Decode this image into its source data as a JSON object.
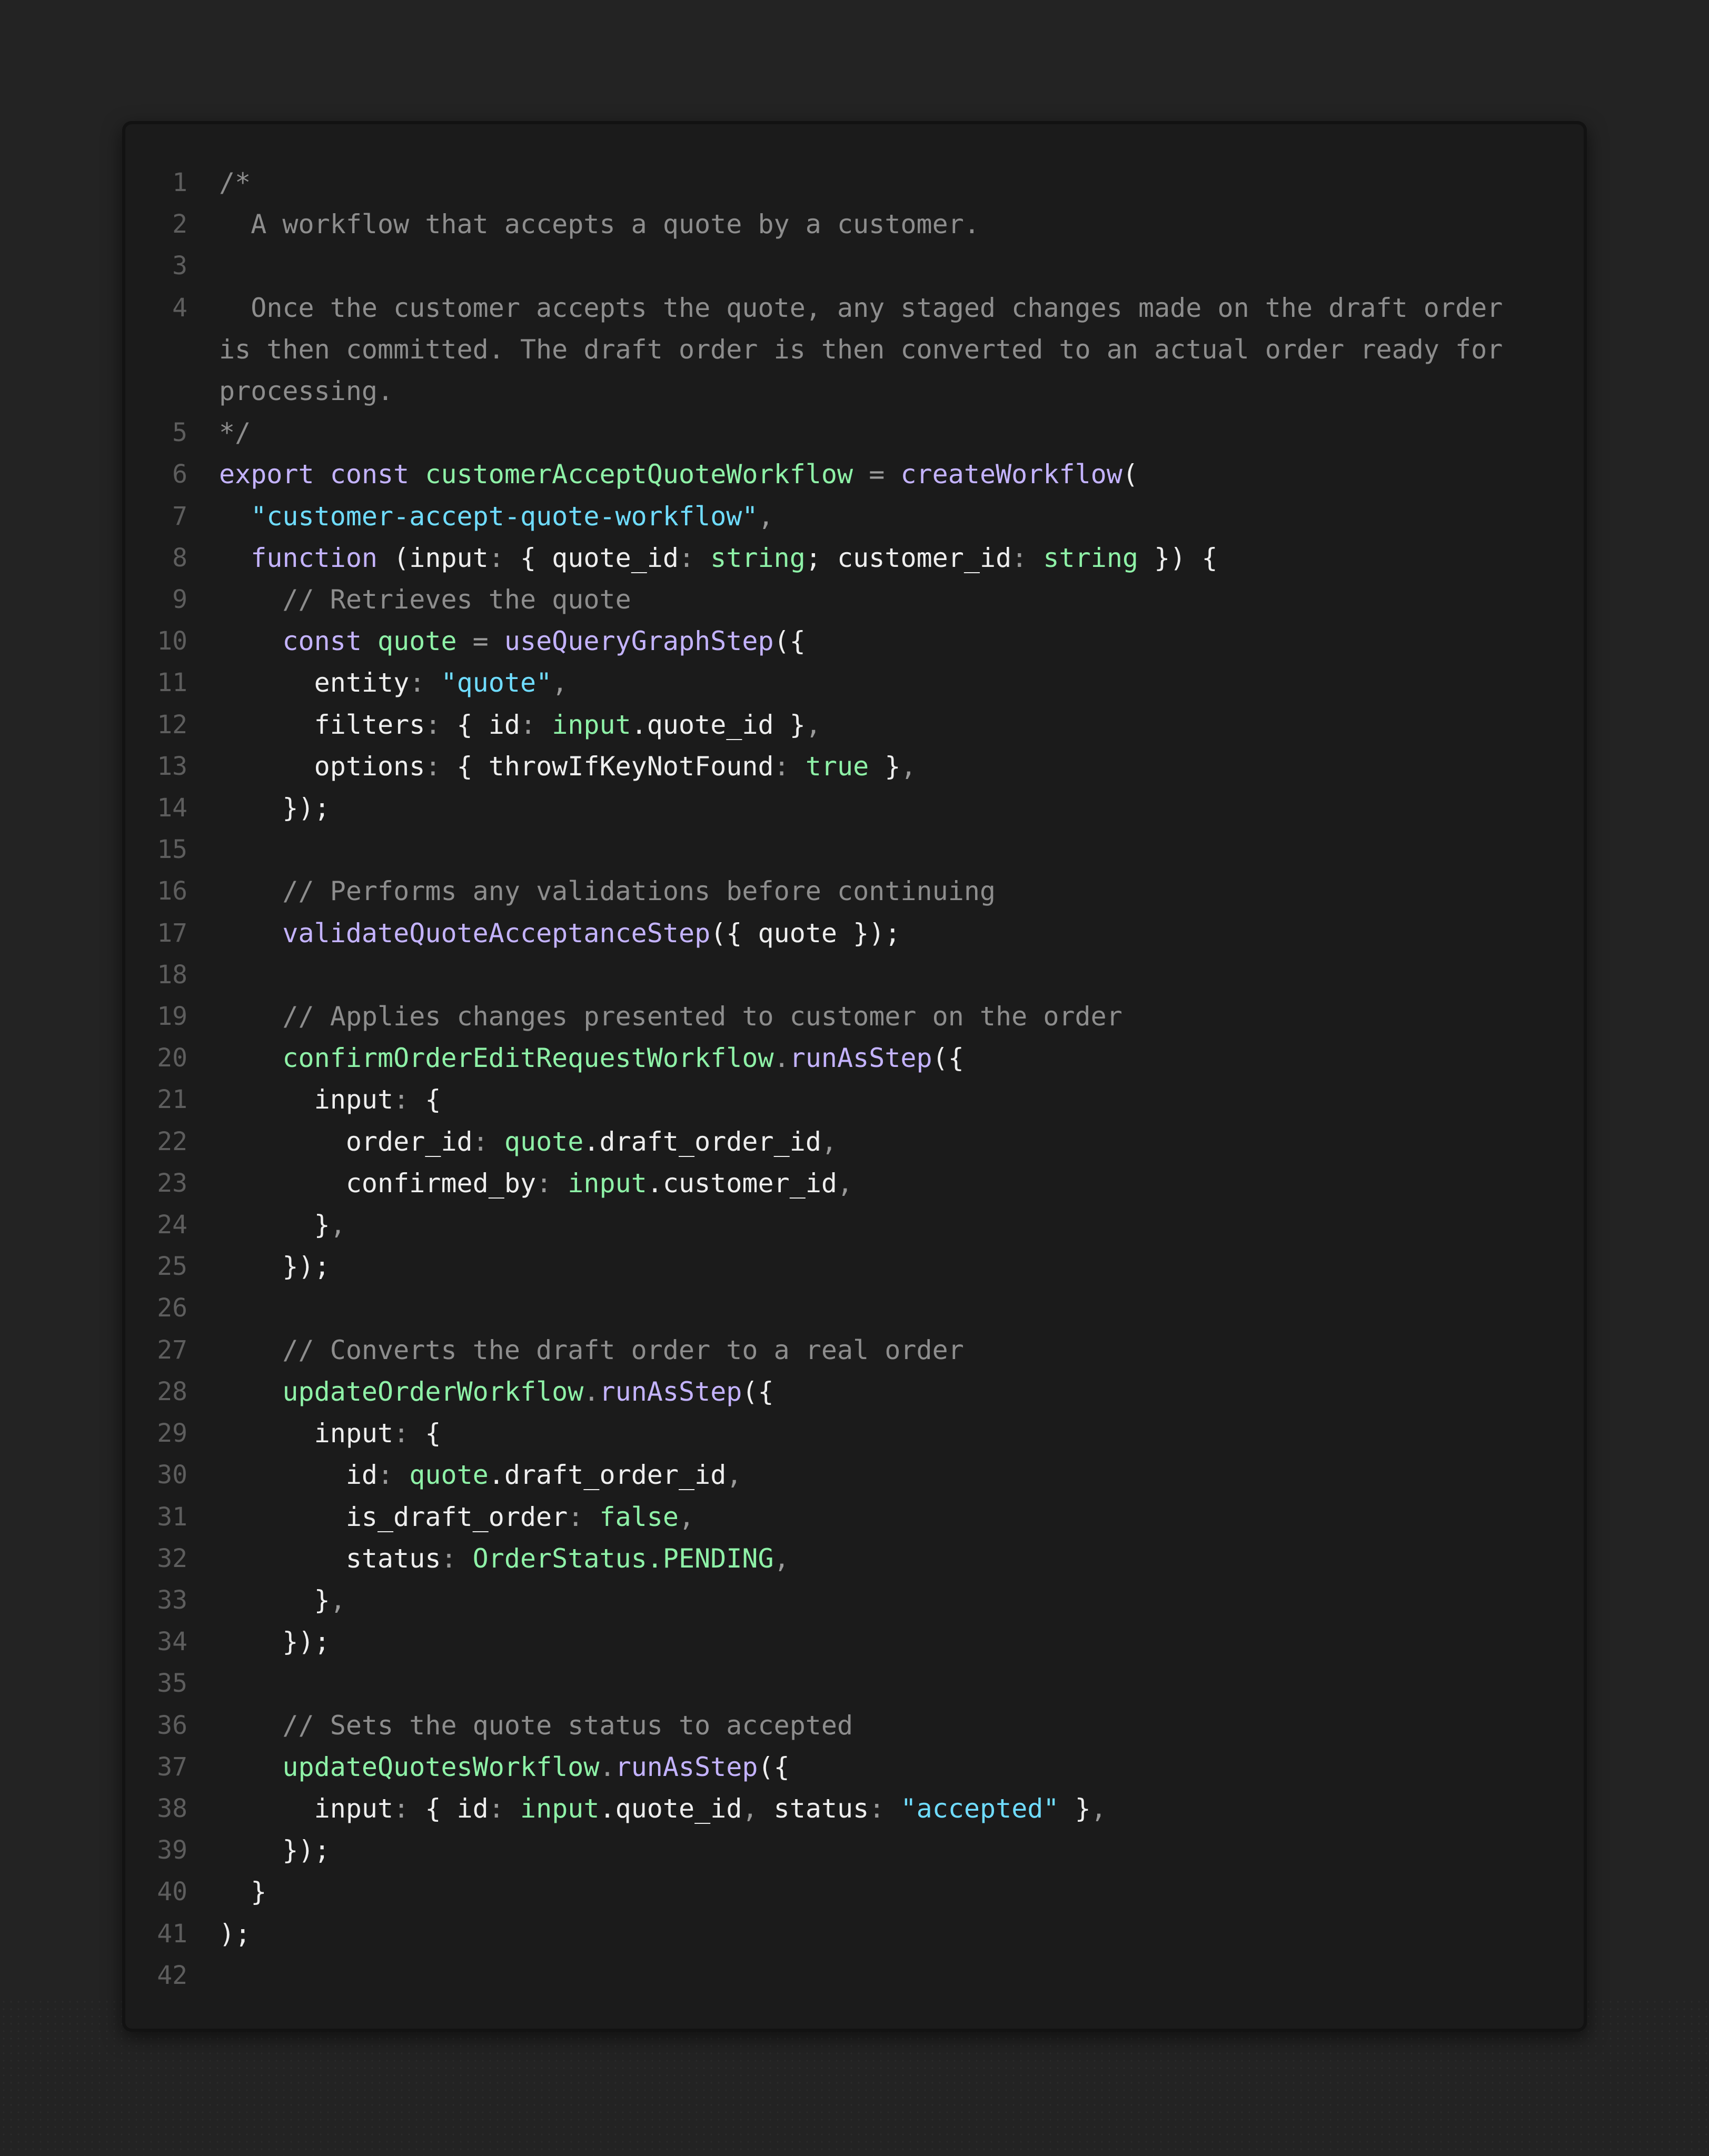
{
  "colors": {
    "background": "#232323",
    "editor_background": "#1b1b1b",
    "line_number": "#5d5d5d",
    "keyword": "#c4b3ff",
    "function": "#c4b3ff",
    "identifier_green": "#8ef1a7",
    "type": "#8ef1a7",
    "string": "#6fdcff",
    "comment": "#8d8d8d",
    "punctuation": "#9a9a9a",
    "plain": "#eeeeee"
  },
  "editor": {
    "language": "typescript",
    "lines": [
      {
        "n": "1",
        "tokens": [
          {
            "t": "/*",
            "c": "com"
          }
        ]
      },
      {
        "n": "2",
        "tokens": [
          {
            "t": "  A workflow that accepts a quote by a customer.",
            "c": "com"
          }
        ]
      },
      {
        "n": "3",
        "tokens": []
      },
      {
        "n": "4",
        "tokens": [
          {
            "t": "  Once the customer accepts the quote, any staged changes made on the draft order is then committed. The draft order is then converted to an actual order ready for processing.",
            "c": "com"
          }
        ]
      },
      {
        "n": "5",
        "tokens": [
          {
            "t": "*/",
            "c": "com"
          }
        ]
      },
      {
        "n": "6",
        "tokens": [
          {
            "t": "export",
            "c": "kw"
          },
          {
            "t": " ",
            "c": "plain"
          },
          {
            "t": "const",
            "c": "kw"
          },
          {
            "t": " ",
            "c": "plain"
          },
          {
            "t": "customerAcceptQuoteWorkflow",
            "c": "cls"
          },
          {
            "t": " = ",
            "c": "punc"
          },
          {
            "t": "createWorkflow",
            "c": "fn"
          },
          {
            "t": "(",
            "c": "plain"
          }
        ]
      },
      {
        "n": "7",
        "tokens": [
          {
            "t": "  ",
            "c": "plain"
          },
          {
            "t": "\"customer-accept-quote-workflow\"",
            "c": "str"
          },
          {
            "t": ",",
            "c": "punc"
          }
        ]
      },
      {
        "n": "8",
        "tokens": [
          {
            "t": "  ",
            "c": "plain"
          },
          {
            "t": "function",
            "c": "kw"
          },
          {
            "t": " (input",
            "c": "plain"
          },
          {
            "t": ":",
            "c": "punc"
          },
          {
            "t": " { quote_id",
            "c": "plain"
          },
          {
            "t": ":",
            "c": "punc"
          },
          {
            "t": " ",
            "c": "plain"
          },
          {
            "t": "string",
            "c": "type"
          },
          {
            "t": "; customer_id",
            "c": "plain"
          },
          {
            "t": ":",
            "c": "punc"
          },
          {
            "t": " ",
            "c": "plain"
          },
          {
            "t": "string",
            "c": "type"
          },
          {
            "t": " }) {",
            "c": "plain"
          }
        ]
      },
      {
        "n": "9",
        "tokens": [
          {
            "t": "    // Retrieves the quote",
            "c": "com"
          }
        ]
      },
      {
        "n": "10",
        "tokens": [
          {
            "t": "    ",
            "c": "plain"
          },
          {
            "t": "const",
            "c": "kw"
          },
          {
            "t": " ",
            "c": "plain"
          },
          {
            "t": "quote",
            "c": "cls"
          },
          {
            "t": " = ",
            "c": "punc"
          },
          {
            "t": "useQueryGraphStep",
            "c": "fn"
          },
          {
            "t": "({",
            "c": "plain"
          }
        ]
      },
      {
        "n": "11",
        "tokens": [
          {
            "t": "      entity",
            "c": "plain"
          },
          {
            "t": ":",
            "c": "punc"
          },
          {
            "t": " ",
            "c": "plain"
          },
          {
            "t": "\"quote\"",
            "c": "str"
          },
          {
            "t": ",",
            "c": "punc"
          }
        ]
      },
      {
        "n": "12",
        "tokens": [
          {
            "t": "      filters",
            "c": "plain"
          },
          {
            "t": ":",
            "c": "punc"
          },
          {
            "t": " { id",
            "c": "plain"
          },
          {
            "t": ":",
            "c": "punc"
          },
          {
            "t": " ",
            "c": "plain"
          },
          {
            "t": "input",
            "c": "cls"
          },
          {
            "t": ".quote_id }",
            "c": "plain"
          },
          {
            "t": ",",
            "c": "punc"
          }
        ]
      },
      {
        "n": "13",
        "tokens": [
          {
            "t": "      options",
            "c": "plain"
          },
          {
            "t": ":",
            "c": "punc"
          },
          {
            "t": " { throwIfKeyNotFound",
            "c": "plain"
          },
          {
            "t": ":",
            "c": "punc"
          },
          {
            "t": " ",
            "c": "plain"
          },
          {
            "t": "true",
            "c": "cls"
          },
          {
            "t": " }",
            "c": "plain"
          },
          {
            "t": ",",
            "c": "punc"
          }
        ]
      },
      {
        "n": "14",
        "tokens": [
          {
            "t": "    });",
            "c": "plain"
          }
        ]
      },
      {
        "n": "15",
        "tokens": []
      },
      {
        "n": "16",
        "tokens": [
          {
            "t": "    // Performs any validations before continuing",
            "c": "com"
          }
        ]
      },
      {
        "n": "17",
        "tokens": [
          {
            "t": "    ",
            "c": "plain"
          },
          {
            "t": "validateQuoteAcceptanceStep",
            "c": "fn"
          },
          {
            "t": "({ quote });",
            "c": "plain"
          }
        ]
      },
      {
        "n": "18",
        "tokens": []
      },
      {
        "n": "19",
        "tokens": [
          {
            "t": "    // Applies changes presented to customer on the order",
            "c": "com"
          }
        ]
      },
      {
        "n": "20",
        "tokens": [
          {
            "t": "    ",
            "c": "plain"
          },
          {
            "t": "confirmOrderEditRequestWorkflow",
            "c": "cls"
          },
          {
            "t": ".",
            "c": "punc"
          },
          {
            "t": "runAsStep",
            "c": "fn"
          },
          {
            "t": "({",
            "c": "plain"
          }
        ]
      },
      {
        "n": "21",
        "tokens": [
          {
            "t": "      input",
            "c": "plain"
          },
          {
            "t": ":",
            "c": "punc"
          },
          {
            "t": " {",
            "c": "plain"
          }
        ]
      },
      {
        "n": "22",
        "tokens": [
          {
            "t": "        order_id",
            "c": "plain"
          },
          {
            "t": ":",
            "c": "punc"
          },
          {
            "t": " ",
            "c": "plain"
          },
          {
            "t": "quote",
            "c": "cls"
          },
          {
            "t": ".draft_order_id",
            "c": "plain"
          },
          {
            "t": ",",
            "c": "punc"
          }
        ]
      },
      {
        "n": "23",
        "tokens": [
          {
            "t": "        confirmed_by",
            "c": "plain"
          },
          {
            "t": ":",
            "c": "punc"
          },
          {
            "t": " ",
            "c": "plain"
          },
          {
            "t": "input",
            "c": "cls"
          },
          {
            "t": ".customer_id",
            "c": "plain"
          },
          {
            "t": ",",
            "c": "punc"
          }
        ]
      },
      {
        "n": "24",
        "tokens": [
          {
            "t": "      }",
            "c": "plain"
          },
          {
            "t": ",",
            "c": "punc"
          }
        ]
      },
      {
        "n": "25",
        "tokens": [
          {
            "t": "    });",
            "c": "plain"
          }
        ]
      },
      {
        "n": "26",
        "tokens": []
      },
      {
        "n": "27",
        "tokens": [
          {
            "t": "    // Converts the draft order to a real order",
            "c": "com"
          }
        ]
      },
      {
        "n": "28",
        "tokens": [
          {
            "t": "    ",
            "c": "plain"
          },
          {
            "t": "updateOrderWorkflow",
            "c": "cls"
          },
          {
            "t": ".",
            "c": "punc"
          },
          {
            "t": "runAsStep",
            "c": "fn"
          },
          {
            "t": "({",
            "c": "plain"
          }
        ]
      },
      {
        "n": "29",
        "tokens": [
          {
            "t": "      input",
            "c": "plain"
          },
          {
            "t": ":",
            "c": "punc"
          },
          {
            "t": " {",
            "c": "plain"
          }
        ]
      },
      {
        "n": "30",
        "tokens": [
          {
            "t": "        id",
            "c": "plain"
          },
          {
            "t": ":",
            "c": "punc"
          },
          {
            "t": " ",
            "c": "plain"
          },
          {
            "t": "quote",
            "c": "cls"
          },
          {
            "t": ".draft_order_id",
            "c": "plain"
          },
          {
            "t": ",",
            "c": "punc"
          }
        ]
      },
      {
        "n": "31",
        "tokens": [
          {
            "t": "        is_draft_order",
            "c": "plain"
          },
          {
            "t": ":",
            "c": "punc"
          },
          {
            "t": " ",
            "c": "plain"
          },
          {
            "t": "false",
            "c": "cls"
          },
          {
            "t": ",",
            "c": "punc"
          }
        ]
      },
      {
        "n": "32",
        "tokens": [
          {
            "t": "        status",
            "c": "plain"
          },
          {
            "t": ":",
            "c": "punc"
          },
          {
            "t": " ",
            "c": "plain"
          },
          {
            "t": "OrderStatus.PENDING",
            "c": "cls"
          },
          {
            "t": ",",
            "c": "punc"
          }
        ]
      },
      {
        "n": "33",
        "tokens": [
          {
            "t": "      }",
            "c": "plain"
          },
          {
            "t": ",",
            "c": "punc"
          }
        ]
      },
      {
        "n": "34",
        "tokens": [
          {
            "t": "    });",
            "c": "plain"
          }
        ]
      },
      {
        "n": "35",
        "tokens": []
      },
      {
        "n": "36",
        "tokens": [
          {
            "t": "    // Sets the quote status to accepted",
            "c": "com"
          }
        ]
      },
      {
        "n": "37",
        "tokens": [
          {
            "t": "    ",
            "c": "plain"
          },
          {
            "t": "updateQuotesWorkflow",
            "c": "cls"
          },
          {
            "t": ".",
            "c": "punc"
          },
          {
            "t": "runAsStep",
            "c": "fn"
          },
          {
            "t": "({",
            "c": "plain"
          }
        ]
      },
      {
        "n": "38",
        "tokens": [
          {
            "t": "      input",
            "c": "plain"
          },
          {
            "t": ":",
            "c": "punc"
          },
          {
            "t": " { id",
            "c": "plain"
          },
          {
            "t": ":",
            "c": "punc"
          },
          {
            "t": " ",
            "c": "plain"
          },
          {
            "t": "input",
            "c": "cls"
          },
          {
            "t": ".quote_id",
            "c": "plain"
          },
          {
            "t": ",",
            "c": "punc"
          },
          {
            "t": " status",
            "c": "plain"
          },
          {
            "t": ":",
            "c": "punc"
          },
          {
            "t": " ",
            "c": "plain"
          },
          {
            "t": "\"accepted\"",
            "c": "str"
          },
          {
            "t": " }",
            "c": "plain"
          },
          {
            "t": ",",
            "c": "punc"
          }
        ]
      },
      {
        "n": "39",
        "tokens": [
          {
            "t": "    });",
            "c": "plain"
          }
        ]
      },
      {
        "n": "40",
        "tokens": [
          {
            "t": "  }",
            "c": "plain"
          }
        ]
      },
      {
        "n": "41",
        "tokens": [
          {
            "t": ");",
            "c": "plain"
          }
        ]
      },
      {
        "n": "42",
        "tokens": []
      }
    ]
  }
}
